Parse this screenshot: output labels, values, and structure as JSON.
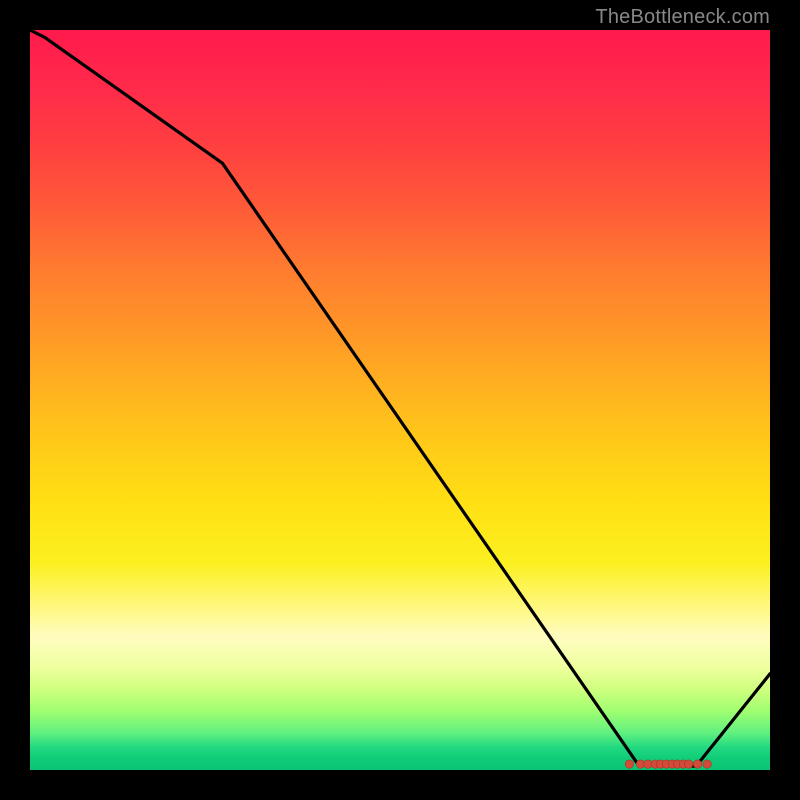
{
  "attribution": "TheBottleneck.com",
  "colors": {
    "line": "#000000",
    "marker_fill": "#d24a3a",
    "marker_stroke": "#b03020",
    "background": "#000000"
  },
  "chart_data": {
    "type": "line",
    "title": "",
    "xlabel": "",
    "ylabel": "",
    "xlim": [
      0,
      100
    ],
    "ylim": [
      0,
      100
    ],
    "x": [
      0,
      2,
      26,
      82,
      90,
      100
    ],
    "values": [
      100,
      99,
      82,
      1,
      0.5,
      13
    ],
    "marker_cluster": {
      "y_approx": 0.8,
      "x_points": [
        81,
        82.5,
        83.5,
        84.5,
        85.2,
        86,
        86.8,
        87.5,
        88.3,
        89,
        90.2,
        91.5
      ]
    }
  }
}
